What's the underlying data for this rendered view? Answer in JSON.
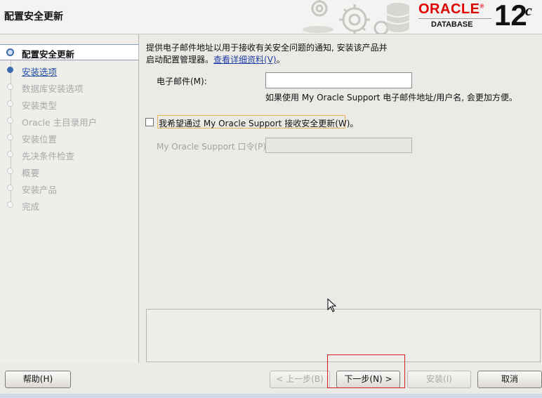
{
  "header": {
    "title": "配置安全更新",
    "brand": "ORACLE",
    "product": "DATABASE",
    "version": "12",
    "version_suffix": "c"
  },
  "sidebar": {
    "steps": [
      {
        "label": "配置安全更新",
        "state": "active"
      },
      {
        "label": "安装选项",
        "state": "link"
      },
      {
        "label": "数据库安装选项",
        "state": "disabled"
      },
      {
        "label": "安装类型",
        "state": "disabled"
      },
      {
        "label": "Oracle 主目录用户",
        "state": "disabled"
      },
      {
        "label": "安装位置",
        "state": "disabled"
      },
      {
        "label": "先决条件检查",
        "state": "disabled"
      },
      {
        "label": "概要",
        "state": "disabled"
      },
      {
        "label": "安装产品",
        "state": "disabled"
      },
      {
        "label": "完成",
        "state": "disabled"
      }
    ]
  },
  "main": {
    "intro_line1": "提供电子邮件地址以用于接收有关安全问题的通知, 安装该产品并",
    "intro_line2": "启动配置管理器。",
    "details_link": "查看详细资料(V)",
    "intro_end": "。",
    "email_label": "电子邮件(M):",
    "email_value": "",
    "email_hint": "如果使用 My Oracle Support 电子邮件地址/用户名, 会更加方便。",
    "receive_updates_label": "我希望通过 My Oracle Support 接收安全更新(W)。",
    "receive_updates_checked": false,
    "password_label": "My Oracle Support 口令(P):",
    "password_value": ""
  },
  "footer": {
    "help": "帮助(H)",
    "back": "< 上一步(B)",
    "next": "下一步(N) >",
    "install": "安装(I)",
    "cancel": "取消"
  },
  "colors": {
    "brand_red": "#e00000",
    "link_blue": "#1f3fa8",
    "highlight_red": "#d02020"
  }
}
